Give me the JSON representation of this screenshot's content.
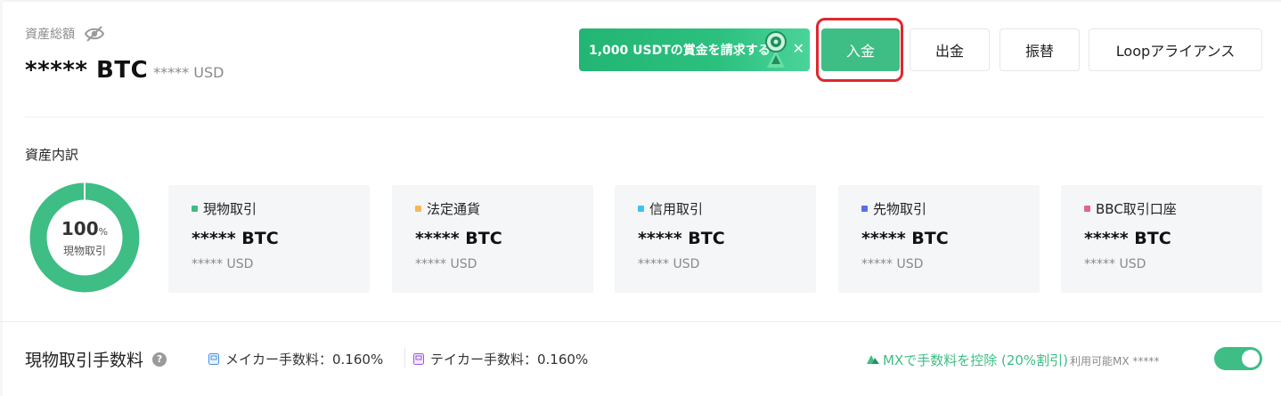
{
  "summary": {
    "title": "資産総額",
    "btc_value": "***** BTC",
    "usd_value": "***** USD"
  },
  "promo": {
    "label": "1,000 USDTの賞金を請求する",
    "close_glyph": "✕"
  },
  "actions": {
    "deposit": "入金",
    "withdraw": "出金",
    "transfer": "振替",
    "loop": "Loopアライアンス"
  },
  "breakdown": {
    "title": "資産内訳",
    "donut": {
      "percent": "100",
      "percent_sign": "%",
      "label": "現物取引",
      "fraction": 1.0,
      "color": "#3ebd85"
    },
    "accounts": [
      {
        "name": "現物取引",
        "btc": "***** BTC",
        "usd": "***** USD",
        "color": "#3ebd85"
      },
      {
        "name": "法定通貨",
        "btc": "***** BTC",
        "usd": "***** USD",
        "color": "#f5b85a"
      },
      {
        "name": "信用取引",
        "btc": "***** BTC",
        "usd": "***** USD",
        "color": "#3cc4ee"
      },
      {
        "name": "先物取引",
        "btc": "***** BTC",
        "usd": "***** USD",
        "color": "#5a6cf0"
      },
      {
        "name": "BBC取引口座",
        "btc": "***** BTC",
        "usd": "***** USD",
        "color": "#e0668a"
      }
    ]
  },
  "fees": {
    "title": "現物取引手数料",
    "help_glyph": "?",
    "maker": "メイカー手数料：0.160%",
    "taker": "テイカー手数料：0.160%",
    "mx_discount": "MXで手数料を控除 (20%割引)",
    "mx_available": "利用可能MX *****",
    "toggle_on": true
  },
  "colors": {
    "accent": "#3ebd85",
    "highlight_border": "#e0272e"
  },
  "icons": [
    "eye-slash-icon",
    "gift-coin-icon",
    "close-icon",
    "help-icon",
    "maker-icon",
    "taker-icon",
    "mx-logo-icon"
  ]
}
